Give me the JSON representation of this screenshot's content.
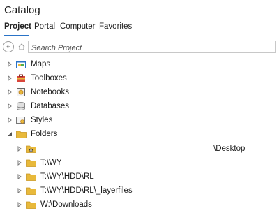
{
  "panel": {
    "title": "Catalog"
  },
  "tabs": [
    {
      "label": "Project",
      "active": true
    },
    {
      "label": "Portal"
    },
    {
      "label": "Computer"
    },
    {
      "label": "Favorites"
    }
  ],
  "search": {
    "placeholder": "Search Project"
  },
  "tree": {
    "items": [
      {
        "label": "Maps",
        "icon": "map-icon",
        "expanded": false
      },
      {
        "label": "Toolboxes",
        "icon": "toolbox-icon",
        "expanded": false
      },
      {
        "label": "Notebooks",
        "icon": "notebook-icon",
        "expanded": false
      },
      {
        "label": "Databases",
        "icon": "database-icon",
        "expanded": false
      },
      {
        "label": "Styles",
        "icon": "style-icon",
        "expanded": false
      },
      {
        "label": "Folders",
        "icon": "folder-icon",
        "expanded": true
      }
    ],
    "folders": [
      {
        "label": "\\Desktop",
        "icon": "home-folder-icon",
        "redacted_prefix": true
      },
      {
        "label": "T:\\WY",
        "icon": "folder-icon"
      },
      {
        "label": "T:\\WY\\HDD\\RL",
        "icon": "folder-icon"
      },
      {
        "label": "T:\\WY\\HDD\\RL\\_layerfiles",
        "icon": "folder-icon"
      },
      {
        "label": "W:\\Downloads",
        "icon": "folder-icon"
      }
    ]
  },
  "colors": {
    "accent": "#2a73c7",
    "folder": "#e8b93b"
  }
}
